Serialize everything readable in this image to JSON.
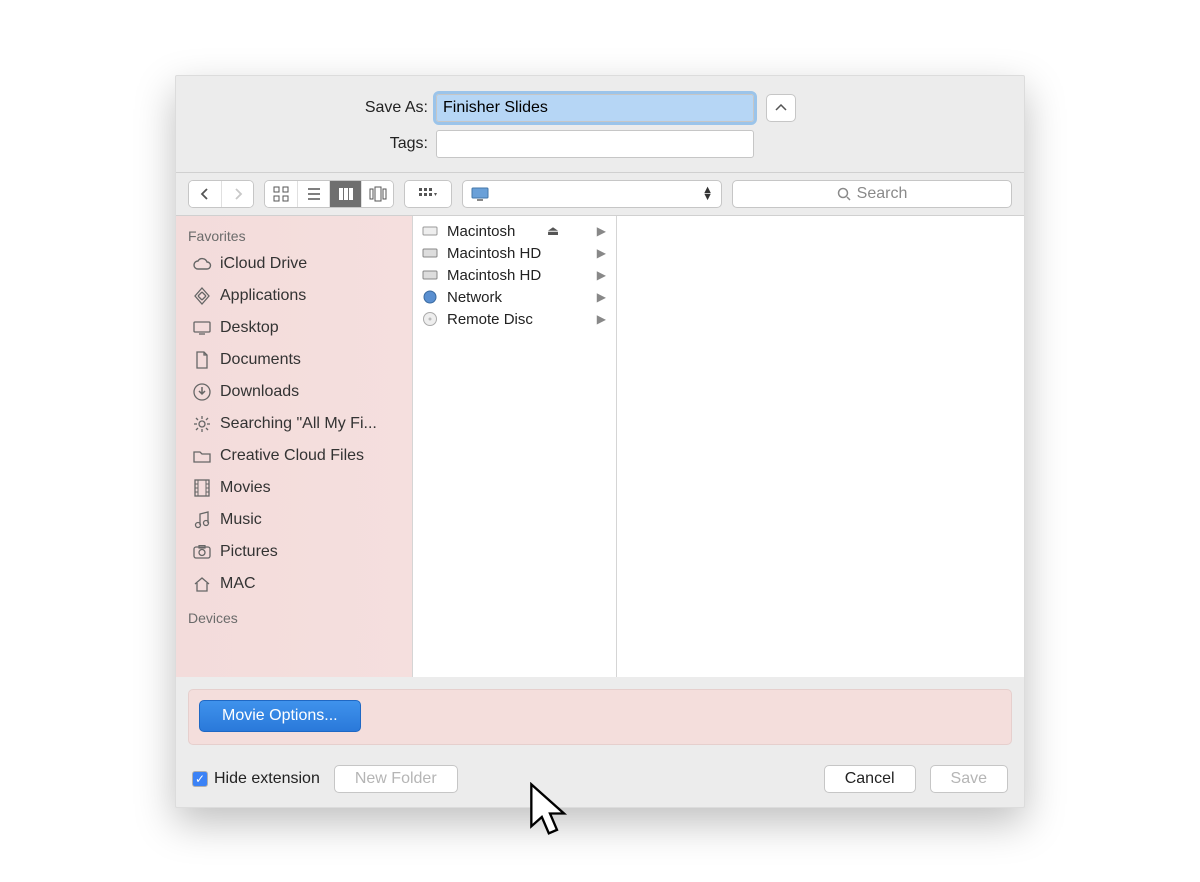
{
  "header": {
    "save_as_label": "Save As:",
    "save_as_value": "Finisher Slides",
    "tags_label": "Tags:",
    "tags_value": ""
  },
  "toolbar": {
    "search_placeholder": "Search",
    "location_name": ""
  },
  "sidebar": {
    "section_favorites": "Favorites",
    "section_devices": "Devices",
    "items": [
      {
        "label": "iCloud Drive"
      },
      {
        "label": "Applications"
      },
      {
        "label": "Desktop"
      },
      {
        "label": "Documents"
      },
      {
        "label": "Downloads"
      },
      {
        "label": "Searching \"All My Fi..."
      },
      {
        "label": "Creative Cloud Files"
      },
      {
        "label": "Movies"
      },
      {
        "label": "Music"
      },
      {
        "label": "Pictures"
      },
      {
        "label": "MAC"
      }
    ]
  },
  "column": {
    "items": [
      {
        "label": "Macintosh",
        "eject": true
      },
      {
        "label": "Macintosh HD"
      },
      {
        "label": "Macintosh HD"
      },
      {
        "label": "Network"
      },
      {
        "label": "Remote Disc"
      }
    ]
  },
  "accessory": {
    "movie_options_label": "Movie Options..."
  },
  "footer": {
    "hide_extension_label": "Hide extension",
    "hide_extension_checked": true,
    "new_folder_label": "New Folder",
    "cancel_label": "Cancel",
    "save_label": "Save"
  }
}
